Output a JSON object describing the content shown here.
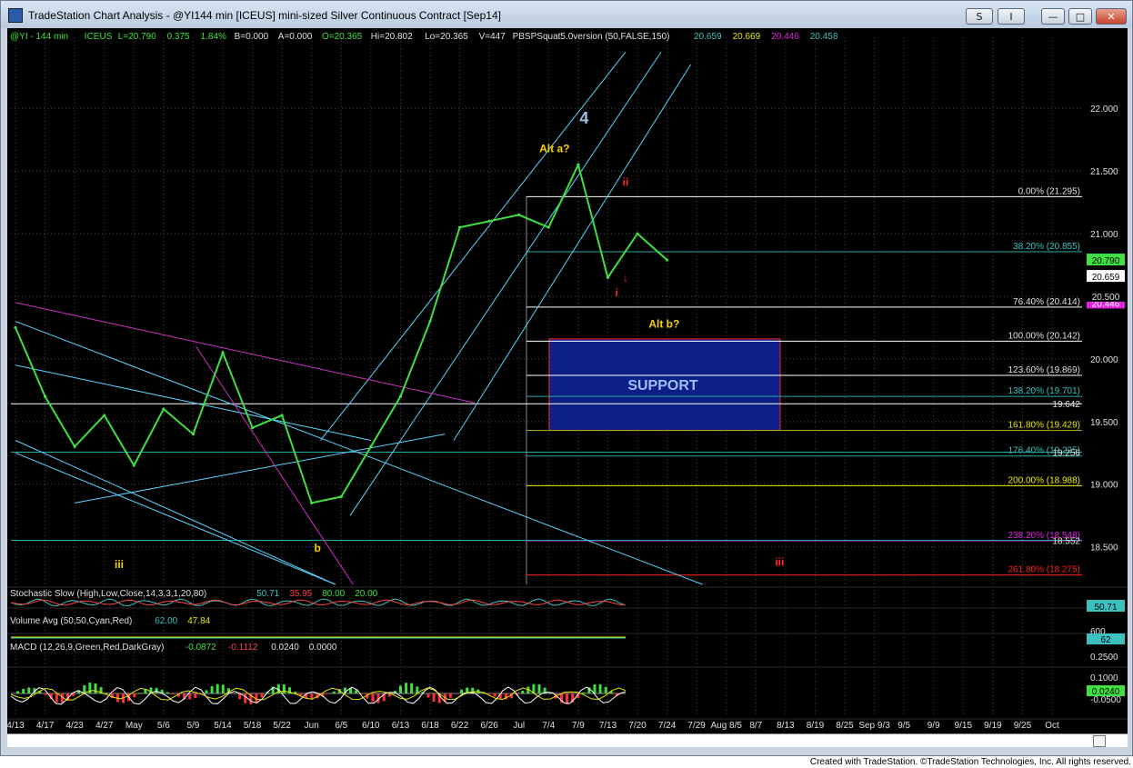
{
  "window": {
    "title": "TradeStation Chart Analysis - @YI144 min [ICEUS] mini-sized Silver Continuous Contract [Sep14]",
    "btn_s": "S",
    "btn_i": "I",
    "btn_min": "—",
    "btn_max": "□",
    "btn_close": "✕",
    "footer": "Created with TradeStation. ©TradeStation Technologies, Inc. All rights reserved."
  },
  "colors": {
    "background": "#000000",
    "price": "#3fe03f",
    "grid": "#4a4a4a",
    "axis_text": "#e0e0e0",
    "fib_line": "#ffffff",
    "support_fill": "#0b1f86",
    "support_border": "#ff2020",
    "channel": "#58d4ff",
    "triangle": "#d12fc6",
    "wave_yellow": "#f5d000",
    "wave_red": "#ff2020",
    "wave_blue": "#9cc0e8"
  },
  "header": {
    "symbol": "@YI - 144 min",
    "exchange": "ICEUS",
    "last": "L=20.790",
    "chg": "0.375",
    "pct": "1.84%",
    "bid": "B=0.000",
    "ask": "A=0.000",
    "open": "O=20.365",
    "high": "Hi=20.802",
    "low": "Lo=20.365",
    "vol": "V=447",
    "study": "PBSPSquat5.0version (50,FALSE,150)",
    "study_v1": "20.659",
    "study_v2": "20.669",
    "study_v3": "20.446",
    "study_v4": "20.458"
  },
  "chart_data": [
    {
      "type": "line",
      "title": "@YI - 144 min ICEUS",
      "x": [
        "4/13",
        "4/17",
        "4/23",
        "4/27",
        "May",
        "5/6",
        "5/9",
        "5/14",
        "5/18",
        "5/22",
        "Jun",
        "6/5",
        "6/10",
        "6/13",
        "6/18",
        "6/22",
        "6/26",
        "Jul",
        "7/4",
        "7/9",
        "7/13",
        "7/20",
        "7/24"
      ],
      "series": [
        {
          "name": "@YI - 144 min",
          "values": [
            20.25,
            19.7,
            19.3,
            19.55,
            19.15,
            19.6,
            19.4,
            20.05,
            19.45,
            19.55,
            18.85,
            18.9,
            19.3,
            19.7,
            20.3,
            21.05,
            21.1,
            21.15,
            21.05,
            21.55,
            20.65,
            21.0,
            20.79
          ]
        }
      ],
      "ylim": [
        18.2,
        22.35
      ],
      "y_ticks": [
        "22.000",
        "21.500",
        "21.000",
        "20.500",
        "20.000",
        "19.500",
        "19.000",
        "18.500"
      ],
      "x_ticks": [
        "4/13",
        "4/17",
        "4/23",
        "4/27",
        "May",
        "5/6",
        "5/9",
        "5/14",
        "5/18",
        "5/22",
        "Jun",
        "6/5",
        "6/10",
        "6/13",
        "6/18",
        "6/22",
        "6/26",
        "Jul",
        "7/4",
        "7/9",
        "7/13",
        "7/20",
        "7/24",
        "7/29",
        "Aug 8/5",
        "8/7",
        "8/13",
        "8/19",
        "8/25",
        "Sep 9/3",
        "9/5",
        "9/9",
        "9/15",
        "9/19",
        "9/25",
        "Oct"
      ],
      "price_tags": [
        {
          "text": "20.790",
          "value": 20.79,
          "color": "#3fe03f",
          "text_color": "#000000"
        },
        {
          "text": "20.659",
          "value": 20.659,
          "color": "#ffffff",
          "text_color": "#000000"
        },
        {
          "text": "20.446",
          "value": 20.446,
          "color": "#e020e0",
          "text_color": "#ffffff"
        },
        {
          "text": "20.500",
          "value": 20.5,
          "color": "#000000",
          "text_color": "#e0e0e0"
        }
      ],
      "fib_levels": [
        {
          "label": "0.00% (21.295)",
          "value": 21.295,
          "color": "#ffffff",
          "text": "#e0e0e0"
        },
        {
          "label": "38.20% (20.855)",
          "value": 20.855,
          "color": "#2aa6a6",
          "text": "#3cc0c0"
        },
        {
          "label": "76.40% (20.414)",
          "value": 20.414,
          "color": "#ffffff",
          "text": "#e0e0e0"
        },
        {
          "label": "100.00% (20.142)",
          "value": 20.142,
          "color": "#ffffff",
          "text": "#e0e0e0"
        },
        {
          "label": "123.60% (19.869)",
          "value": 19.869,
          "color": "#ffffff",
          "text": "#e0e0e0"
        },
        {
          "label": "138.20% (19.701)",
          "value": 19.701,
          "color": "#2aa6a6",
          "text": "#3cc0c0"
        },
        {
          "label": "161.80% (19.429)",
          "value": 19.429,
          "color": "#b5b520",
          "text": "#e6e600"
        },
        {
          "label": "176.40% (19.225)",
          "value": 19.225,
          "color": "#2aa6a6",
          "text": "#3cc0c0"
        },
        {
          "label": "200.00% (18.988)",
          "value": 18.988,
          "color": "#f0f000",
          "text": "#f0f000"
        },
        {
          "label": "238.20% (18.548)",
          "value": 18.548,
          "color": "#e020e0",
          "text": "#e020e0"
        },
        {
          "label": "261.80% (18.275)",
          "value": 18.275,
          "color": "#ff2020",
          "text": "#ff2020"
        }
      ],
      "support_zone": {
        "label": "SUPPORT",
        "top": 20.16,
        "bottom": 19.43
      },
      "horizontal_labels": [
        {
          "text": "19.642",
          "value": 19.642
        },
        {
          "text": "19.256",
          "value": 19.256
        },
        {
          "text": "18.552",
          "value": 18.552
        }
      ],
      "wave_labels": [
        {
          "text": "4",
          "date_index": 19.2,
          "value": 21.88,
          "color": "#9cc0e8"
        },
        {
          "text": "Alt a?",
          "date_index": 18.2,
          "value": 21.65,
          "color": "#f5d000"
        },
        {
          "text": "ii",
          "date_index": 20.6,
          "value": 21.38,
          "color": "#ff2020"
        },
        {
          "text": "↓",
          "date_index": 20.6,
          "value": 20.62,
          "color": "#ff2020"
        },
        {
          "text": "i",
          "date_index": 20.3,
          "value": 20.5,
          "color": "#ff2020"
        },
        {
          "text": "Alt b?",
          "date_index": 21.9,
          "value": 20.25,
          "color": "#f5d000"
        },
        {
          "text": "iii",
          "date_index": 3.5,
          "value": 18.33,
          "color": "#f5d000"
        },
        {
          "text": "b",
          "date_index": 10.2,
          "value": 18.46,
          "color": "#f5d000"
        },
        {
          "text": "iii",
          "date_index": 25.8,
          "value": 18.35,
          "color": "#ff2020"
        }
      ]
    },
    {
      "type": "line",
      "title": "Stochastic Slow (High,Low,Close,14,3,3,1,20,80)",
      "series": [
        {
          "name": "SlowK",
          "values": [
            50.71
          ]
        },
        {
          "name": "SlowD",
          "values": [
            35.95
          ]
        },
        {
          "name": "OverBought",
          "values": [
            80.0
          ]
        },
        {
          "name": "OverSold",
          "values": [
            20.0
          ]
        }
      ],
      "value_labels": [
        "50.71",
        "35.95",
        "80.00",
        "20.00"
      ],
      "tag": "50.71"
    },
    {
      "type": "bar",
      "title": "Volume Avg (50,50,Cyan,Red)",
      "series": [
        {
          "name": "Volume",
          "values": [
            62.0
          ]
        },
        {
          "name": "Avg",
          "values": [
            47.84
          ]
        }
      ],
      "value_labels": [
        "62.00",
        "47.84"
      ],
      "axis_label": "600",
      "tag": "62"
    },
    {
      "type": "line",
      "title": "MACD (12,26,9,Green,Red,DarkGray)",
      "series": [
        {
          "name": "MACD",
          "values": [
            -0.0872
          ]
        },
        {
          "name": "MACDAvg",
          "values": [
            -0.1112
          ]
        },
        {
          "name": "MACDDiff",
          "values": [
            0.024
          ]
        },
        {
          "name": "ZeroLine",
          "values": [
            0.0
          ]
        }
      ],
      "value_labels": [
        "-0.0872",
        "-0.1112",
        "0.0240",
        "0.0000"
      ],
      "y_ticks": [
        "0.2500",
        "0.1000",
        "0.0240",
        "-0.0500"
      ],
      "tag": "0.0240"
    }
  ]
}
